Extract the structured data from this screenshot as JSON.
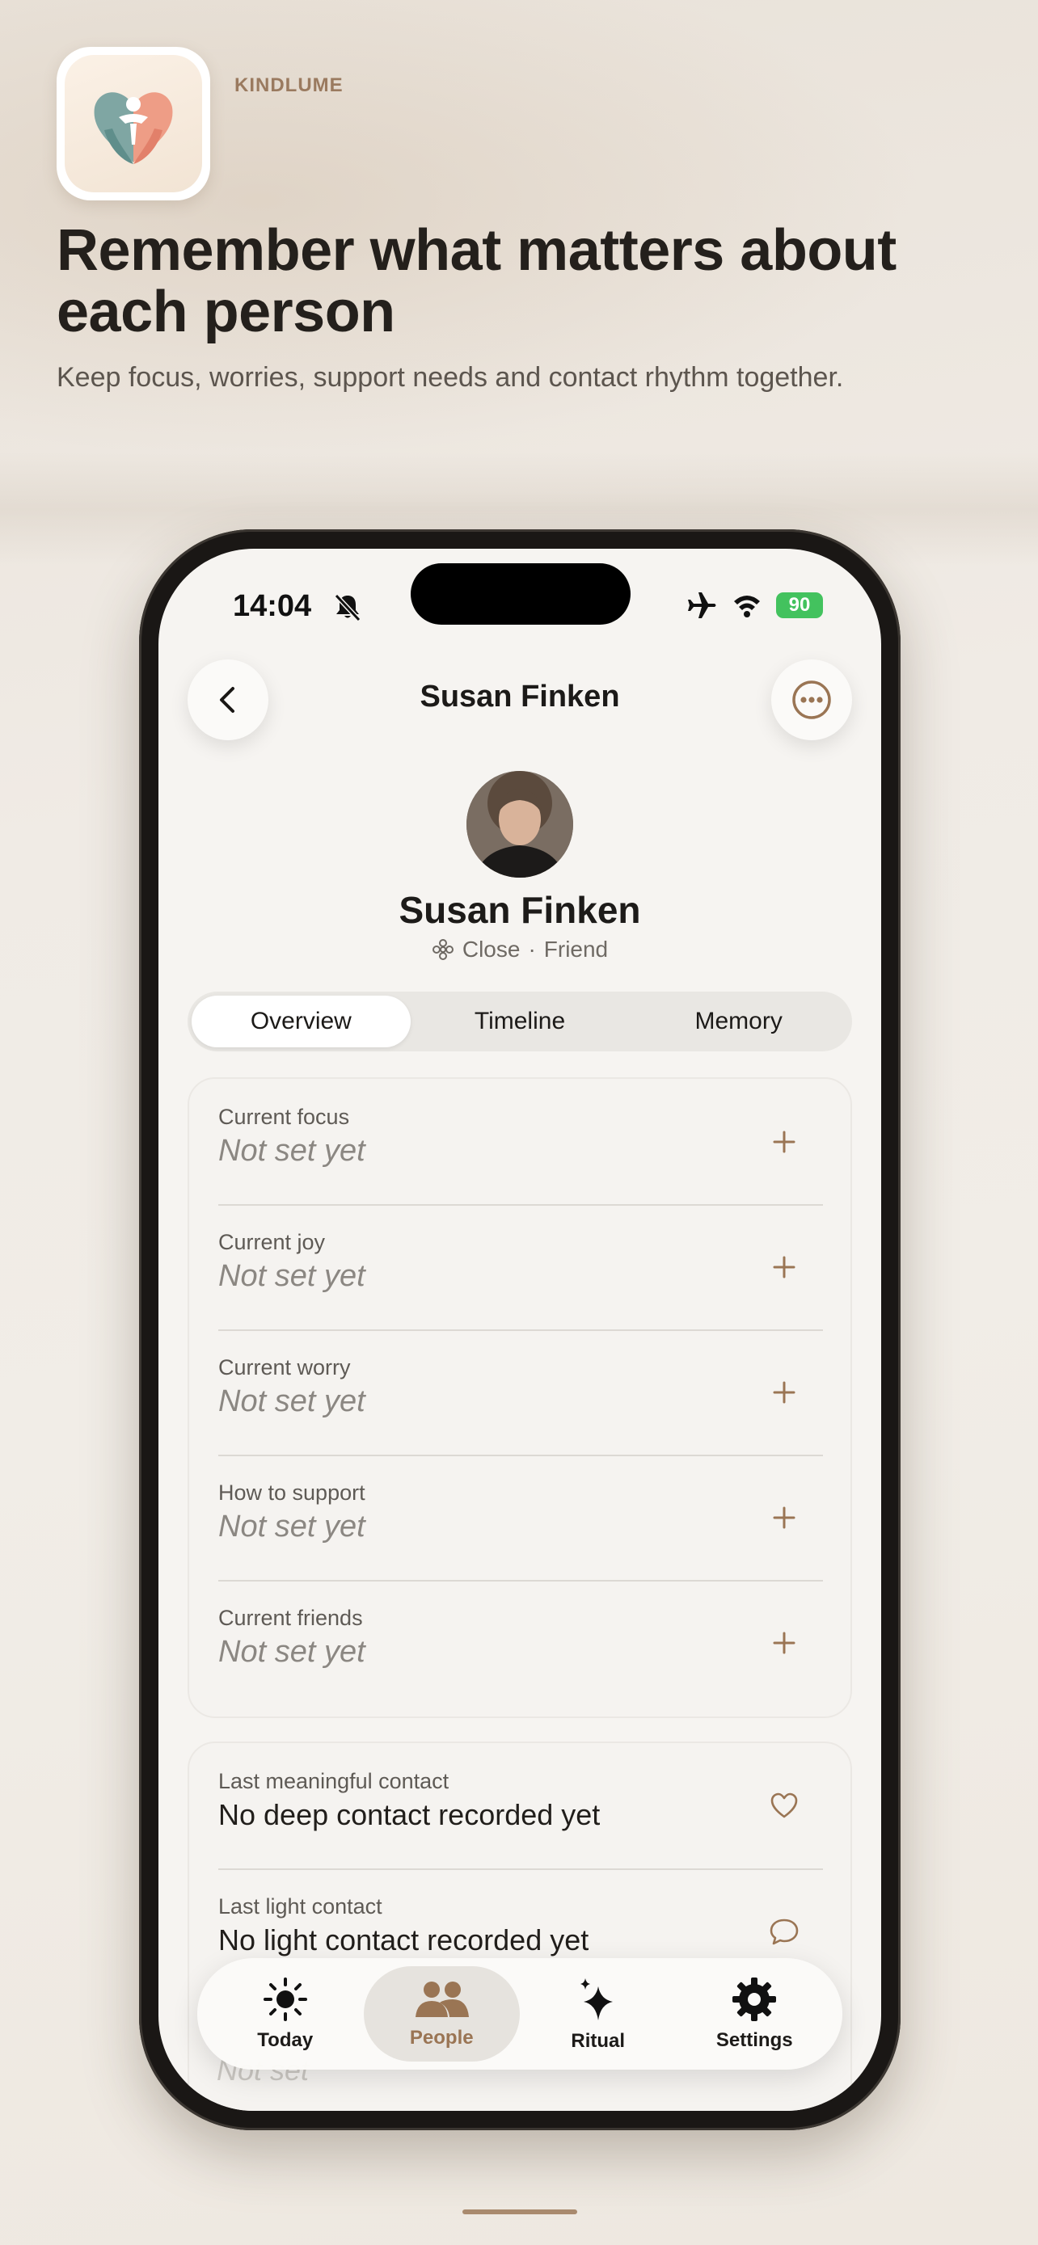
{
  "brand": "KINDLUME",
  "headline": "Remember what matters about each person",
  "subheadline": "Keep focus, worries, support needs and contact rhythm together.",
  "status": {
    "time": "14:04",
    "battery": "90"
  },
  "nav": {
    "title": "Susan Finken"
  },
  "profile": {
    "name": "Susan Finken",
    "circle": "Close",
    "separator": "·",
    "relation": "Friend"
  },
  "tabs": [
    {
      "label": "Overview",
      "active": true
    },
    {
      "label": "Timeline",
      "active": false
    },
    {
      "label": "Memory",
      "active": false
    }
  ],
  "overview": [
    {
      "label": "Current focus",
      "value": "Not set yet"
    },
    {
      "label": "Current joy",
      "value": "Not set yet"
    },
    {
      "label": "Current worry",
      "value": "Not set yet"
    },
    {
      "label": "How to support",
      "value": "Not set yet"
    },
    {
      "label": "Current friends",
      "value": "Not set yet"
    }
  ],
  "contacts": [
    {
      "label": "Last meaningful contact",
      "value": "No deep contact recorded yet",
      "icon": "heart-icon"
    },
    {
      "label": "Last light contact",
      "value": "No light contact recorded yet",
      "icon": "chat-bubble-icon"
    }
  ],
  "faded_value": "Not set",
  "tabbar": [
    {
      "label": "Today",
      "icon": "sun-icon",
      "active": false
    },
    {
      "label": "People",
      "icon": "people-icon",
      "active": true
    },
    {
      "label": "Ritual",
      "icon": "sparkles-icon",
      "active": false
    },
    {
      "label": "Settings",
      "icon": "gear-icon",
      "active": false
    }
  ],
  "colors": {
    "accent": "#9a7554",
    "battery": "#43c25e",
    "background": "#f6f4f1"
  }
}
